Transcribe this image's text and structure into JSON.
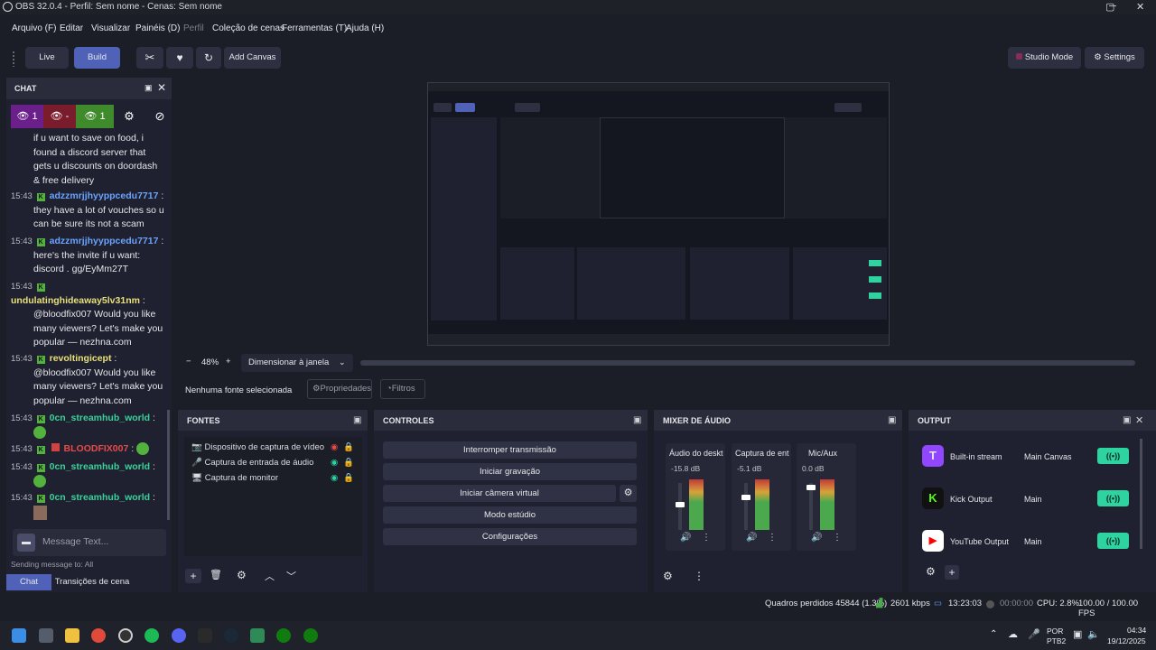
{
  "window": {
    "title": "OBS 32.0.4 - Perfil: Sem nome - Cenas: Sem nome",
    "controls": [
      "─",
      "▢",
      "✕"
    ]
  },
  "menu": [
    "Arquivo (F)",
    "Editar",
    "Visualizar",
    "Painéis (D)",
    "Perfil",
    "Coleção de cenas",
    "Ferramentas (T)",
    "Ajuda (H)"
  ],
  "toolbar": {
    "live": "Live",
    "build": "Build",
    "add_canvas": "Add Canvas",
    "studio_mode": "Studio Mode",
    "settings": "Settings"
  },
  "chat": {
    "title": "CHAT",
    "stats": [
      "1",
      "-",
      "1"
    ],
    "messages": [
      {
        "ts": "",
        "user": "",
        "text": "if u want to save on food, i found a discord server that gets u discounts on doordash & free delivery"
      },
      {
        "ts": "15:43",
        "user": "adzzmrjjhyyppcedu7717",
        "text": "they have a lot of vouches so u can be sure its not a scam"
      },
      {
        "ts": "15:43",
        "user": "adzzmrjjhyyppcedu7717",
        "text": "here's the invite if u want: discord . gg/EyMm27T"
      },
      {
        "ts": "15:43",
        "user": "undulatinghideaway5lv31nm",
        "text": "@bloodfix007 Would you like many viewers? Let's make you popular — nezhna.com"
      },
      {
        "ts": "15:43",
        "user": "revoltingicept",
        "text": "@bloodfix007 Would you like many viewers? Let's make you popular — nezhna.com"
      },
      {
        "ts": "15:43",
        "user": "0cn_streamhub_world",
        "text": ""
      },
      {
        "ts": "15:43",
        "user": "BLOODFIX007",
        "text": ""
      },
      {
        "ts": "15:43",
        "user": "0cn_streamhub_world",
        "text": ""
      },
      {
        "ts": "15:43",
        "user": "0cn_streamhub_world",
        "text": ""
      }
    ],
    "input_placeholder": "Message Text...",
    "sending_to": "Sending message to: All",
    "tabs": [
      "Chat",
      "Transições de cena"
    ]
  },
  "preview": {
    "zoom": "48%",
    "fit": "Dimensionar à janela"
  },
  "source_bar": {
    "status": "Nenhuma fonte selecionada",
    "properties": "Propriedades",
    "filters": "Filtros"
  },
  "sources": {
    "title": "FONTES",
    "items": [
      "Dispositivo de captura de vídeo",
      "Captura de entrada de áudio",
      "Captura de monitor"
    ]
  },
  "controls": {
    "title": "CONTROLES",
    "buttons": [
      "Interromper transmissão",
      "Iniciar gravação",
      "Iniciar câmera virtual",
      "Modo estúdio",
      "Configurações"
    ]
  },
  "mixer": {
    "title": "MIXER DE ÁUDIO",
    "channels": [
      {
        "name": "Áudio do desktop",
        "db": "-15.8 dB",
        "level": 0.55
      },
      {
        "name": "Captura de entrada",
        "db": "-5.1 dB",
        "level": 0.72
      },
      {
        "name": "Mic/Aux",
        "db": "0.0 dB",
        "level": 0.95
      }
    ]
  },
  "output": {
    "title": "OUTPUT",
    "rows": [
      {
        "name": "Built-in stream",
        "canvas": "Main Canvas",
        "logo": "T"
      },
      {
        "name": "Kick Output",
        "canvas": "Main",
        "logo": "K"
      },
      {
        "name": "YouTube Output",
        "canvas": "Main",
        "logo": "▶"
      }
    ]
  },
  "status": {
    "dropped": "Quadros perdidos 45844 (1.3%)",
    "bitrate": "2601 kbps",
    "stream_time": "13:23:03",
    "rec_time": "00:00:00",
    "cpu": "CPU: 2.8%",
    "fps": "100.00 / 100.00 FPS"
  },
  "taskbar": {
    "lang1": "POR",
    "lang2": "PTB2",
    "time": "04:34",
    "date": "19/12/2025"
  },
  "colors": {
    "accent": "#4f62b8",
    "kick_green": "#53b23d",
    "go_green": "#2dd4a0",
    "twitch": "#9146ff",
    "youtube": "#ff0000"
  }
}
